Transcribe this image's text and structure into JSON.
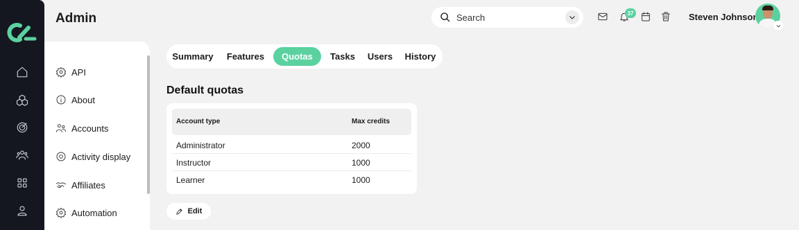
{
  "page": {
    "title": "Admin"
  },
  "colors": {
    "accent": "#5bd1a0",
    "rail": "#14171f",
    "background": "#f2f2f2"
  },
  "search": {
    "placeholder": "Search"
  },
  "header": {
    "icons": [
      "mail-icon",
      "bell-icon",
      "calendar-icon",
      "trash-icon"
    ],
    "notification_count": "37",
    "user_name": "Steven Johnson"
  },
  "rail": {
    "icons": [
      "logo",
      "home-icon",
      "cubes-icon",
      "target-icon",
      "users-icon",
      "grid-icon",
      "user-icon"
    ]
  },
  "sidebar": {
    "items": [
      {
        "label": "API",
        "icon": "gear-icon"
      },
      {
        "label": "About",
        "icon": "info-icon"
      },
      {
        "label": "Accounts",
        "icon": "accounts-icon"
      },
      {
        "label": "Activity display",
        "icon": "activity-icon"
      },
      {
        "label": "Affiliates",
        "icon": "handshake-icon"
      },
      {
        "label": "Automation",
        "icon": "gear-icon"
      }
    ]
  },
  "tabs": [
    {
      "label": "Summary",
      "active": false
    },
    {
      "label": "Features",
      "active": false
    },
    {
      "label": "Quotas",
      "active": true
    },
    {
      "label": "Tasks",
      "active": false
    },
    {
      "label": "Users",
      "active": false
    },
    {
      "label": "History",
      "active": false
    }
  ],
  "quotas": {
    "title": "Default quotas",
    "columns": [
      "Account type",
      "Max credits"
    ],
    "rows": [
      [
        "Administrator",
        "2000"
      ],
      [
        "Instructor",
        "1000"
      ],
      [
        "Learner",
        "1000"
      ]
    ]
  },
  "edit_label": "Edit"
}
